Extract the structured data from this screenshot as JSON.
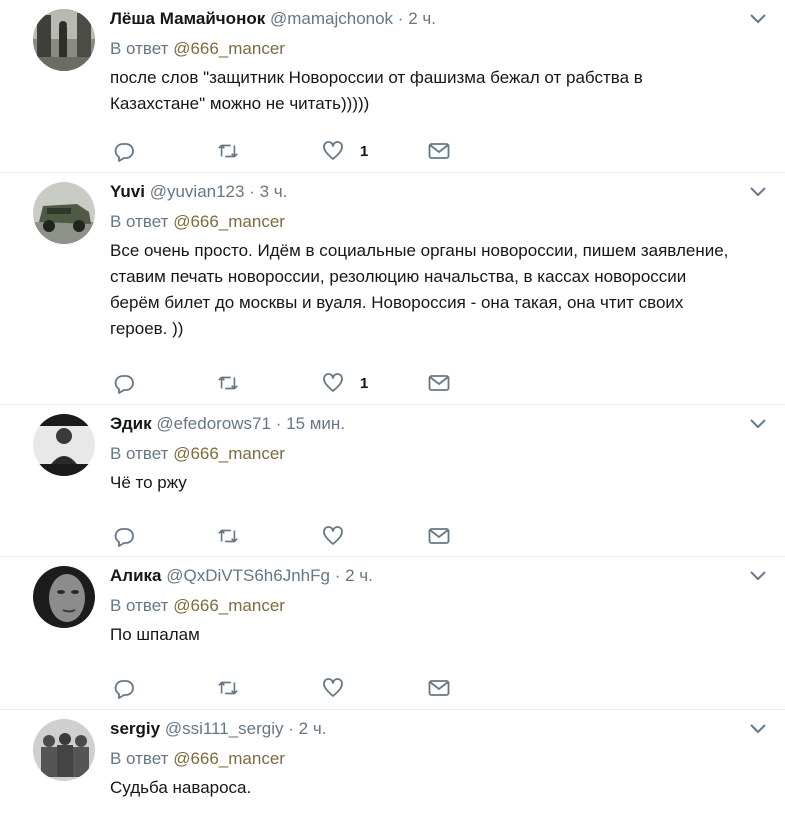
{
  "colors": {
    "name": "#14171a",
    "muted": "#657786",
    "link": "#7e6b3d",
    "divider": "#e6ecf0",
    "icon": "#657786"
  },
  "reply_prefix": "В ответ",
  "tweets": [
    {
      "name": "Лёша Мамайчонок",
      "handle": "@mamajchonok",
      "separator": "·",
      "time": "2 ч.",
      "reply_to": "@666_mancer",
      "text": "после слов \"защитник Новороссии от фашизма бежал от рабства в Казахстане\" можно не читать)))))",
      "likes": "1",
      "avatar_icon": "avatar-street-photo"
    },
    {
      "name": "Yuvi",
      "handle": "@yuvian123",
      "separator": "·",
      "time": "3 ч.",
      "reply_to": "@666_mancer",
      "text": "Все очень просто. Идём в социальные органы новороссии, пишем заявление, ставим печать новороссии, резолюцию начальства, в кассах новороссии берём билет до москвы и вуаля. Новороссия - она такая, она чтит своих героев. ))",
      "likes": "1",
      "avatar_icon": "avatar-armored-vehicle"
    },
    {
      "name": "Эдик",
      "handle": "@efedorows71",
      "separator": "·",
      "time": "15 мин.",
      "reply_to": "@666_mancer",
      "text": "Чё то ржу",
      "likes": "",
      "avatar_icon": "avatar-person-bw"
    },
    {
      "name": "Алика",
      "handle": "@QxDiVTS6h6JnhFg",
      "separator": "·",
      "time": "2 ч.",
      "reply_to": "@666_mancer",
      "text": "По шпалам",
      "likes": "",
      "avatar_icon": "avatar-face-bw"
    },
    {
      "name": "sergiy",
      "handle": "@ssi111_sergiy",
      "separator": "·",
      "time": "2 ч.",
      "reply_to": "@666_mancer",
      "text": "Судьба навароса.",
      "likes": "",
      "avatar_icon": "avatar-group-photo"
    }
  ]
}
